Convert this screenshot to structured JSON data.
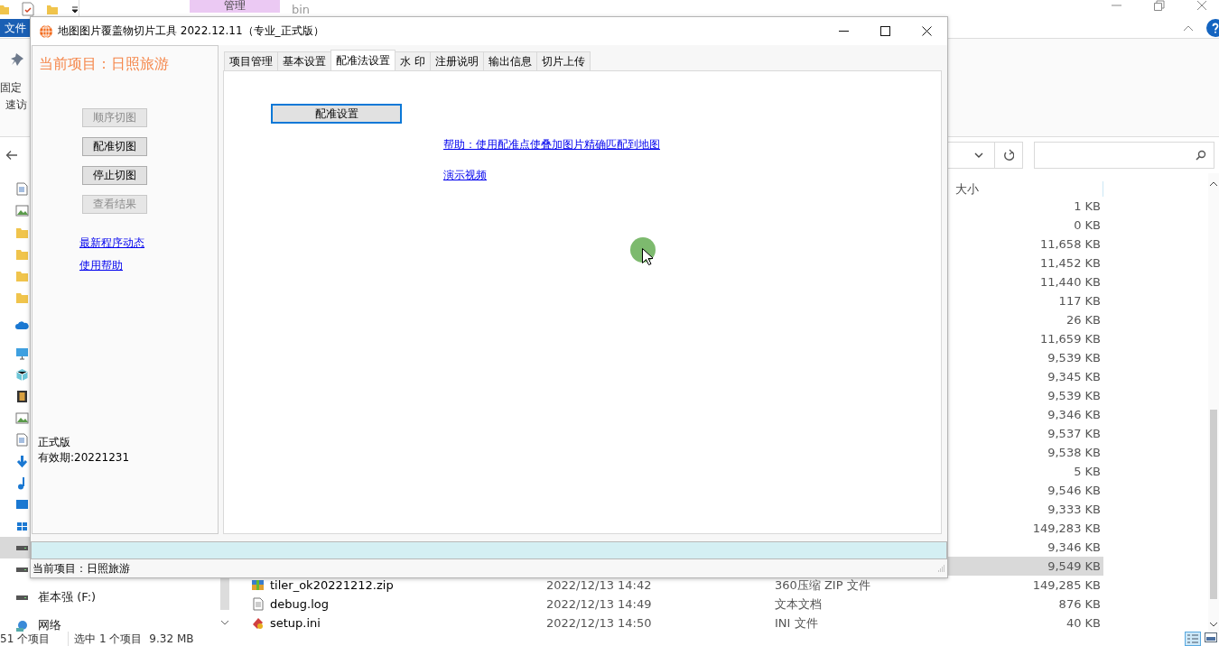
{
  "explorer": {
    "title_bar": {
      "context_tab": "管理",
      "title": "bin"
    },
    "ribbon": {
      "file_tab": "文件",
      "pin_labels": [
        "固定",
        "速访"
      ]
    },
    "nav": {
      "groups": [
        {
          "items": [
            {
              "kind": "doc",
              "selected": false
            },
            {
              "kind": "image",
              "selected": false
            },
            {
              "kind": "folder",
              "selected": false
            },
            {
              "kind": "folder",
              "selected": false
            },
            {
              "kind": "folder",
              "selected": false
            },
            {
              "kind": "folder",
              "selected": false
            }
          ]
        },
        {
          "items": [
            {
              "kind": "cloud",
              "selected": false
            }
          ]
        },
        {
          "items": [
            {
              "kind": "pc",
              "selected": false
            },
            {
              "kind": "cube",
              "selected": false
            },
            {
              "kind": "film",
              "selected": false
            },
            {
              "kind": "image",
              "selected": false
            },
            {
              "kind": "doc",
              "selected": false
            },
            {
              "kind": "download",
              "selected": false
            },
            {
              "kind": "music",
              "selected": false
            },
            {
              "kind": "desktop",
              "selected": false
            },
            {
              "kind": "windows",
              "selected": false
            },
            {
              "kind": "drive",
              "selected": true
            },
            {
              "kind": "drive",
              "selected": false
            }
          ]
        },
        {
          "items": [
            {
              "kind": "drive",
              "label": "崔本强 (F:)",
              "selected": false
            }
          ]
        },
        {
          "items": [
            {
              "kind": "network",
              "label": "网络",
              "selected": false
            }
          ]
        }
      ]
    },
    "files": {
      "size_heading": "大小",
      "rows": [
        {
          "size": "1 KB",
          "selected": false
        },
        {
          "size": "0 KB",
          "selected": false
        },
        {
          "size": "11,658 KB",
          "selected": false
        },
        {
          "size": "11,452 KB",
          "selected": false
        },
        {
          "size": "11,440 KB",
          "selected": false
        },
        {
          "size": "117 KB",
          "selected": false
        },
        {
          "size": "26 KB",
          "selected": false
        },
        {
          "size": "11,659 KB",
          "selected": false
        },
        {
          "size": "9,539 KB",
          "selected": false
        },
        {
          "size": "9,345 KB",
          "selected": false
        },
        {
          "size": "9,539 KB",
          "selected": false
        },
        {
          "size": "9,346 KB",
          "selected": false
        },
        {
          "size": "9,537 KB",
          "selected": false
        },
        {
          "size": "9,538 KB",
          "selected": false
        },
        {
          "size": "5 KB",
          "selected": false
        },
        {
          "size": "9,546 KB",
          "selected": false
        },
        {
          "size": "9,333 KB",
          "selected": false
        },
        {
          "size": "149,283 KB",
          "selected": false
        },
        {
          "size": "9,346 KB",
          "selected": false
        },
        {
          "size": "9,549 KB",
          "selected": true
        },
        {
          "kind": "zip",
          "name": "tiler_ok20221212.zip",
          "modified": "2022/12/13 14:42",
          "type": "360压缩 ZIP 文件",
          "size": "149,285 KB",
          "selected": false
        },
        {
          "kind": "text",
          "name": "debug.log",
          "modified": "2022/12/13 14:49",
          "type": "文本文档",
          "size": "876 KB",
          "selected": false
        },
        {
          "kind": "ini",
          "name": "setup.ini",
          "modified": "2022/12/13 14:50",
          "type": "INI 文件",
          "size": "40 KB",
          "selected": false
        }
      ]
    },
    "status_bar": {
      "item_count": "51 个项目",
      "selection": "选中 1 个项目",
      "selection_size": "9.32 MB"
    }
  },
  "dialog": {
    "title": "地图图片覆盖物切片工具 2022.12.11（专业_正式版）",
    "sidebar": {
      "project": "当前项目：日照旅游",
      "buttons": [
        {
          "label": "顺序切图",
          "disabled": true
        },
        {
          "label": "配准切图",
          "disabled": false
        },
        {
          "label": "停止切图",
          "disabled": false
        },
        {
          "label": "查看结果",
          "disabled": true
        }
      ],
      "links": [
        "最新程序动态",
        "使用帮助"
      ],
      "edition": "正式版",
      "expiry": "有效期:20221231"
    },
    "tabs": [
      {
        "label": "项目管理",
        "selected": false
      },
      {
        "label": "基本设置",
        "selected": false
      },
      {
        "label": "配准法设置",
        "selected": true
      },
      {
        "label": "水 印",
        "selected": false
      },
      {
        "label": "注册说明",
        "selected": false
      },
      {
        "label": "输出信息",
        "selected": false
      },
      {
        "label": "切片上传",
        "selected": false
      }
    ],
    "panel": {
      "button": {
        "label": "配准设置",
        "focused": true
      },
      "links": [
        "帮助：使用配准点使叠加图片精确匹配到地图",
        "演示视频"
      ]
    },
    "status_bar": "当前项目：日照旅游"
  }
}
